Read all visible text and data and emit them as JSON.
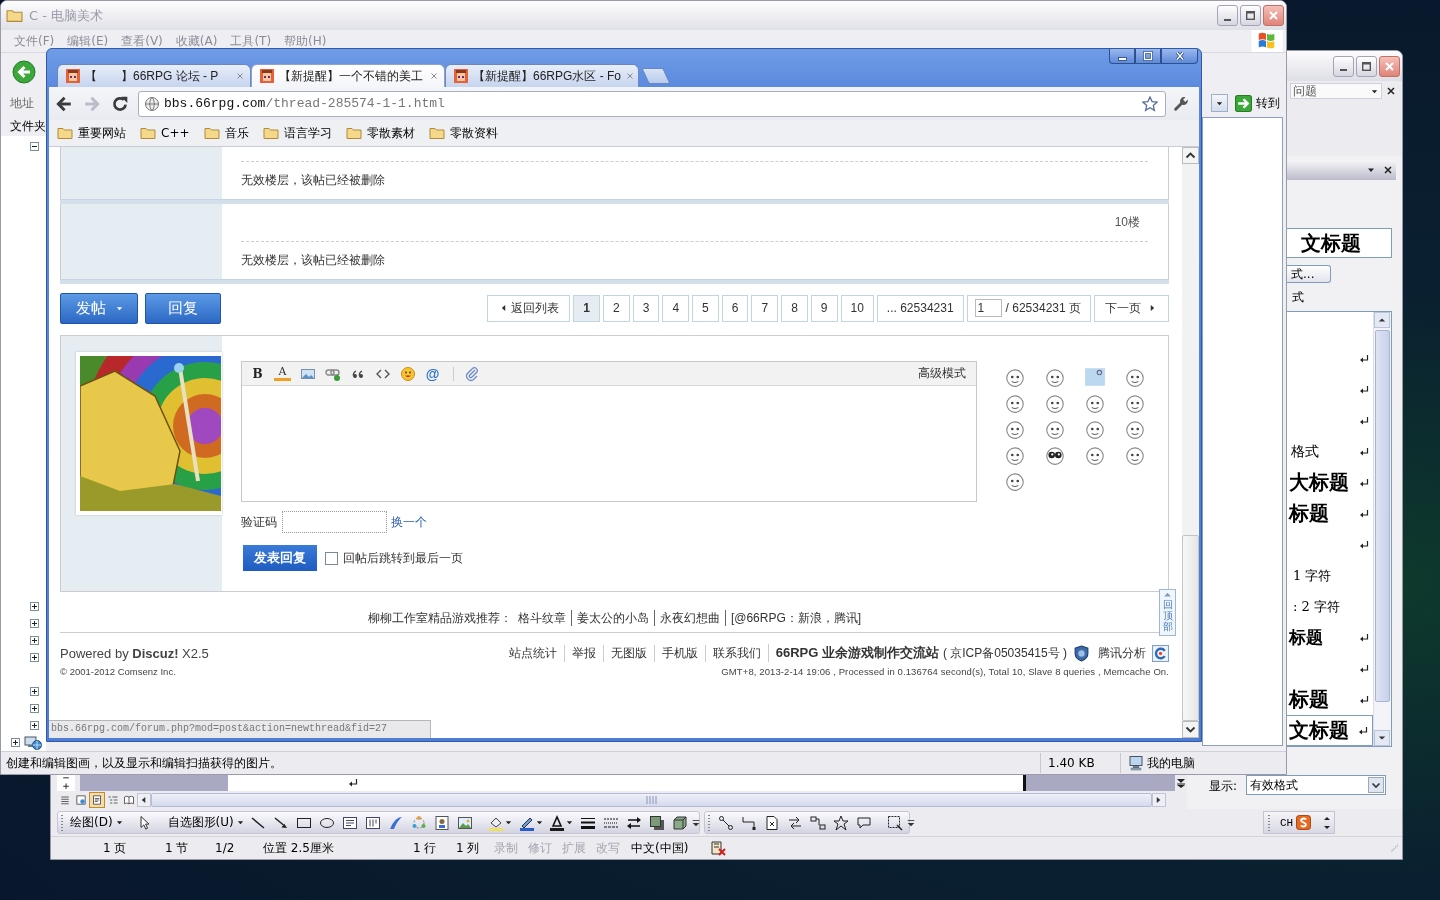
{
  "explorer": {
    "title": "C - 电脑美术",
    "menu": [
      "文件(F)",
      "编辑(E)",
      "查看(V)",
      "收藏(A)",
      "工具(T)",
      "帮助(H)"
    ],
    "address_label": "地址",
    "go_button": "转到",
    "folders_label": "文件夹",
    "tree": [
      {
        "expanded": true
      },
      {
        "expanded": false
      },
      {
        "expanded": false
      },
      {
        "expanded": false
      },
      {
        "expanded": false
      },
      {
        "expanded": false
      },
      {
        "expanded": false
      },
      {
        "expanded": false
      }
    ],
    "network_node": {
      "expanded": false
    },
    "status_bar": {
      "description": "创建和编辑图画，以及显示和编辑扫描获得的图片。",
      "size": "1.40 KB",
      "zone": "我的电脑"
    }
  },
  "browser": {
    "tabs": [
      {
        "title": "【　　】66RPG 论坛 - P",
        "selected": false
      },
      {
        "title": "【新提醒】一个不错的美工",
        "selected": true
      },
      {
        "title": "【新提醒】66RPG水区 - Fo",
        "selected": false
      }
    ],
    "nav_buttons": [
      {
        "kind": "back",
        "disabled": false
      },
      {
        "kind": "forward",
        "disabled": true
      },
      {
        "kind": "reload",
        "disabled": false
      }
    ],
    "url": {
      "host": "bbs.66rpg.com",
      "path": "/thread-285574-1-1.html"
    },
    "bookmarks": [
      "重要网站",
      "C++",
      "音乐",
      "语言学习",
      "零散素材",
      "零散资料"
    ],
    "page": {
      "posts": [
        {
          "message": "无效楼层，该帖已经被删除"
        },
        {
          "floor": "10楼",
          "message": "无效楼层，该帖已经被删除"
        }
      ],
      "post_button": "发帖",
      "reply_button": "回复",
      "pagination": {
        "back": "返回列表",
        "pages": [
          {
            "label": "1",
            "selected": true
          },
          {
            "label": "2",
            "selected": false
          },
          {
            "label": "3",
            "selected": false
          },
          {
            "label": "4",
            "selected": false
          },
          {
            "label": "5",
            "selected": false
          },
          {
            "label": "6",
            "selected": false
          },
          {
            "label": "7",
            "selected": false
          },
          {
            "label": "8",
            "selected": false
          },
          {
            "label": "9",
            "selected": false
          },
          {
            "label": "10",
            "selected": false
          }
        ],
        "last": "... 62534231",
        "page_input": "1",
        "total": "/ 62534231 页",
        "next": "下一页"
      },
      "editor": {
        "tools": [
          {
            "kind": "bold",
            "label": "B"
          },
          {
            "kind": "font_color",
            "label": "A"
          },
          {
            "kind": "image"
          },
          {
            "kind": "link"
          },
          {
            "kind": "quote"
          },
          {
            "kind": "code"
          },
          {
            "kind": "smiley"
          },
          {
            "kind": "mention",
            "label": "@"
          },
          {
            "kind": "attachment"
          }
        ],
        "mode": "高级模式"
      },
      "captcha": {
        "label": "验证码",
        "link": "换一个"
      },
      "submit_button": "发表回复",
      "jump_option": {
        "label": "回帖后跳转到最后一页",
        "checked": false
      },
      "back_to_top": "回顶部",
      "footer": {
        "recommend": "柳柳工作室精品游戏推荐：",
        "games": [
          "格斗纹章",
          "姜太公的小岛",
          "永夜幻想曲"
        ],
        "social": "[@66RPG：新浪，腾讯]",
        "powered": "Powered by **Discuz!** X2.5",
        "copyright": "© 2001-2012 Comsenz Inc.",
        "links": [
          "站点统计",
          "举报",
          "无图版",
          "手机版",
          "联系我们"
        ],
        "site_name": "66RPG 业余游戏制作交流站",
        "icp": "( 京ICP备05035415号 )",
        "analytics": "腾讯分析",
        "stats": "GMT+8, 2013-2-14 19:06 , Processed in 0.136764 second(s), Total 10, Slave 8 queries , Memcache On."
      }
    },
    "status_url": "bbs.66rpg.com/forum.php?mod=post&action=newthread&fid=27"
  },
  "word": {
    "help_box": {
      "value": "问题"
    },
    "styles_pane": {
      "current_style": "文标题",
      "format_button": "式...",
      "list_label": "式",
      "styles": [
        {
          "kind": "mark",
          "selected": false
        },
        {
          "kind": "mark",
          "selected": false
        },
        {
          "kind": "mark",
          "selected": false
        },
        {
          "kind": "plain",
          "text": "格式",
          "selected": false
        },
        {
          "kind": "large",
          "text": "大标题",
          "selected": false
        },
        {
          "kind": "large",
          "text": "标题",
          "selected": false
        },
        {
          "kind": "mark",
          "selected": false
        },
        {
          "kind": "note",
          "text": "1 字符",
          "selected": false
        },
        {
          "kind": "note",
          "text": ": 2 字符",
          "selected": false
        },
        {
          "kind": "medium",
          "text": "标题",
          "selected": false
        },
        {
          "kind": "mark",
          "selected": false
        },
        {
          "kind": "large",
          "text": "标题",
          "selected": false
        },
        {
          "kind": "large",
          "text": "文标题",
          "selected": true
        }
      ],
      "display_label": "显示:",
      "display_value": "有效格式"
    },
    "view_buttons": [
      {
        "selected": false
      },
      {
        "selected": false
      },
      {
        "selected": true
      },
      {
        "selected": false
      },
      {
        "selected": false
      }
    ],
    "drawing_toolbar": {
      "draw_menu": "绘图(D)",
      "autoshapes_menu": "自选图形(U)"
    },
    "language_bar": {
      "label": "CH"
    },
    "status_bar": [
      {
        "text": "1 页",
        "disabled": false
      },
      {
        "text": "1 节",
        "disabled": false
      },
      {
        "text": "1/2",
        "disabled": false
      },
      {
        "text": "位置 2.5厘米",
        "disabled": false
      },
      {
        "text": "1 行",
        "disabled": false
      },
      {
        "text": "1 列",
        "disabled": false
      },
      {
        "text": "录制",
        "disabled": true
      },
      {
        "text": "修订",
        "disabled": true
      },
      {
        "text": "扩展",
        "disabled": true
      },
      {
        "text": "改写",
        "disabled": true
      },
      {
        "text": "中文(中国)",
        "disabled": false
      }
    ]
  }
}
